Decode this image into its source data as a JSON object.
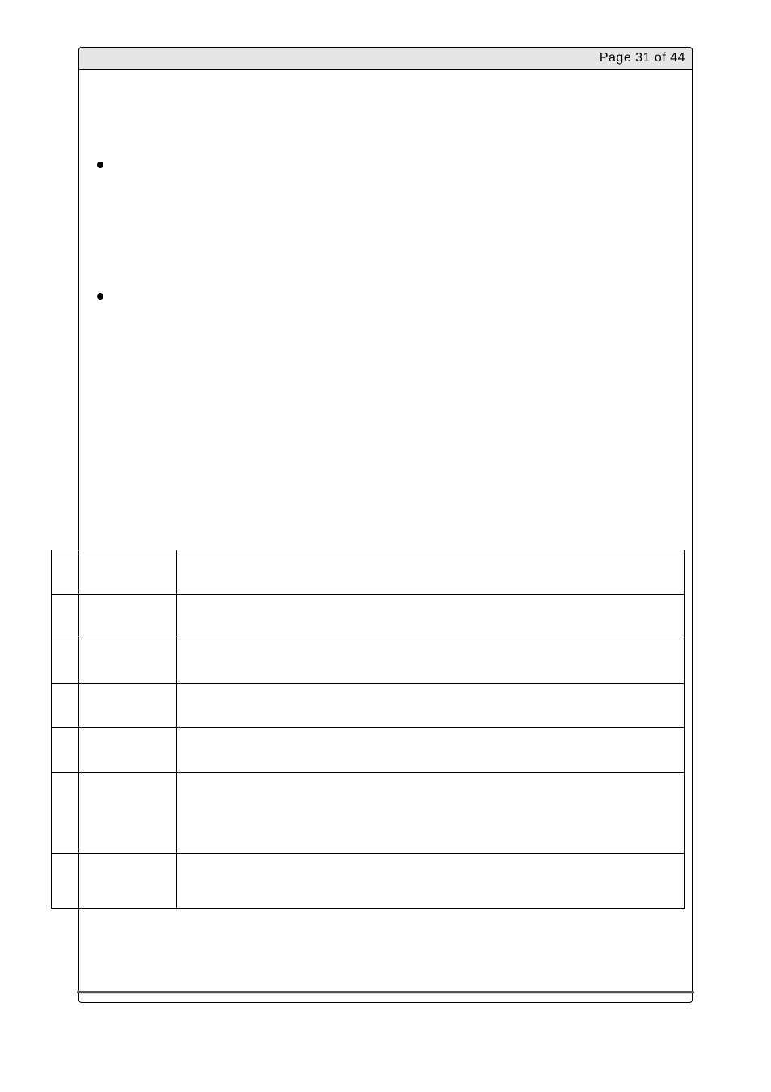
{
  "header": {
    "page_label": "Page 31 of 44"
  }
}
